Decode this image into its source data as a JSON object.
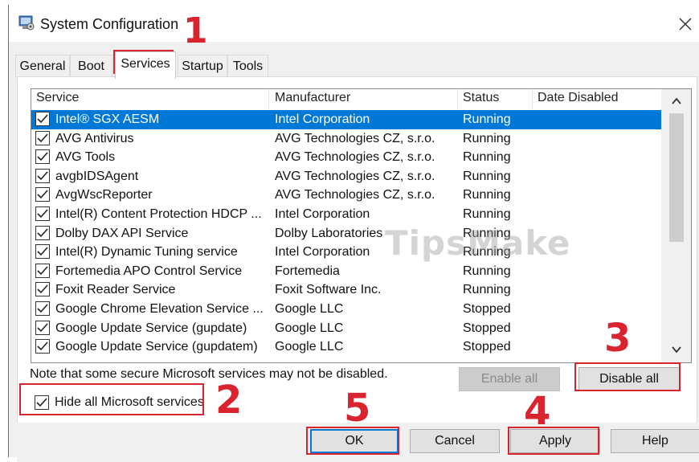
{
  "window": {
    "title": "System Configuration"
  },
  "tabs": [
    {
      "label": "General"
    },
    {
      "label": "Boot"
    },
    {
      "label": "Services"
    },
    {
      "label": "Startup"
    },
    {
      "label": "Tools"
    }
  ],
  "columns": {
    "service": "Service",
    "manufacturer": "Manufacturer",
    "status": "Status",
    "date_disabled": "Date Disabled"
  },
  "services": [
    {
      "name": "Intel® SGX AESM",
      "manufacturer": "Intel Corporation",
      "status": "Running",
      "checked": true,
      "selected": true
    },
    {
      "name": "AVG Antivirus",
      "manufacturer": "AVG Technologies CZ, s.r.o.",
      "status": "Running",
      "checked": true
    },
    {
      "name": "AVG Tools",
      "manufacturer": "AVG Technologies CZ, s.r.o.",
      "status": "Running",
      "checked": true
    },
    {
      "name": "avgbIDSAgent",
      "manufacturer": "AVG Technologies CZ, s.r.o.",
      "status": "Running",
      "checked": true
    },
    {
      "name": "AvgWscReporter",
      "manufacturer": "AVG Technologies CZ, s.r.o.",
      "status": "Running",
      "checked": true
    },
    {
      "name": "Intel(R) Content Protection HDCP ...",
      "manufacturer": "Intel Corporation",
      "status": "Running",
      "checked": true
    },
    {
      "name": "Dolby DAX API Service",
      "manufacturer": "Dolby Laboratories",
      "status": "Running",
      "checked": true
    },
    {
      "name": "Intel(R) Dynamic Tuning service",
      "manufacturer": "Intel Corporation",
      "status": "Running",
      "checked": true
    },
    {
      "name": "Fortemedia APO Control Service",
      "manufacturer": "Fortemedia",
      "status": "Running",
      "checked": true
    },
    {
      "name": "Foxit Reader Service",
      "manufacturer": "Foxit Software Inc.",
      "status": "Running",
      "checked": true
    },
    {
      "name": "Google Chrome Elevation Service ...",
      "manufacturer": "Google LLC",
      "status": "Stopped",
      "checked": true
    },
    {
      "name": "Google Update Service (gupdate)",
      "manufacturer": "Google LLC",
      "status": "Stopped",
      "checked": true
    },
    {
      "name": "Google Update Service (gupdatem)",
      "manufacturer": "Google LLC",
      "status": "Stopped",
      "checked": true
    }
  ],
  "note": "Note that some secure Microsoft services may not be disabled.",
  "buttons": {
    "enable_all": "Enable all",
    "disable_all": "Disable all",
    "ok": "OK",
    "cancel": "Cancel",
    "apply": "Apply",
    "help": "Help"
  },
  "hide_ms": {
    "label": "Hide all Microsoft services",
    "checked": true
  },
  "annotations": {
    "step1": "1",
    "step2": "2",
    "step3": "3",
    "step4": "4",
    "step5": "5"
  },
  "watermark": "TipsMake",
  "colors": {
    "selection": "#0078d7",
    "annotation_red": "#d9232e"
  },
  "icons": {
    "app": "system-configuration-icon",
    "close": "close-icon",
    "checkbox": "checkmark-icon",
    "scroll_up": "chevron-up-icon",
    "scroll_down": "chevron-down-icon"
  }
}
